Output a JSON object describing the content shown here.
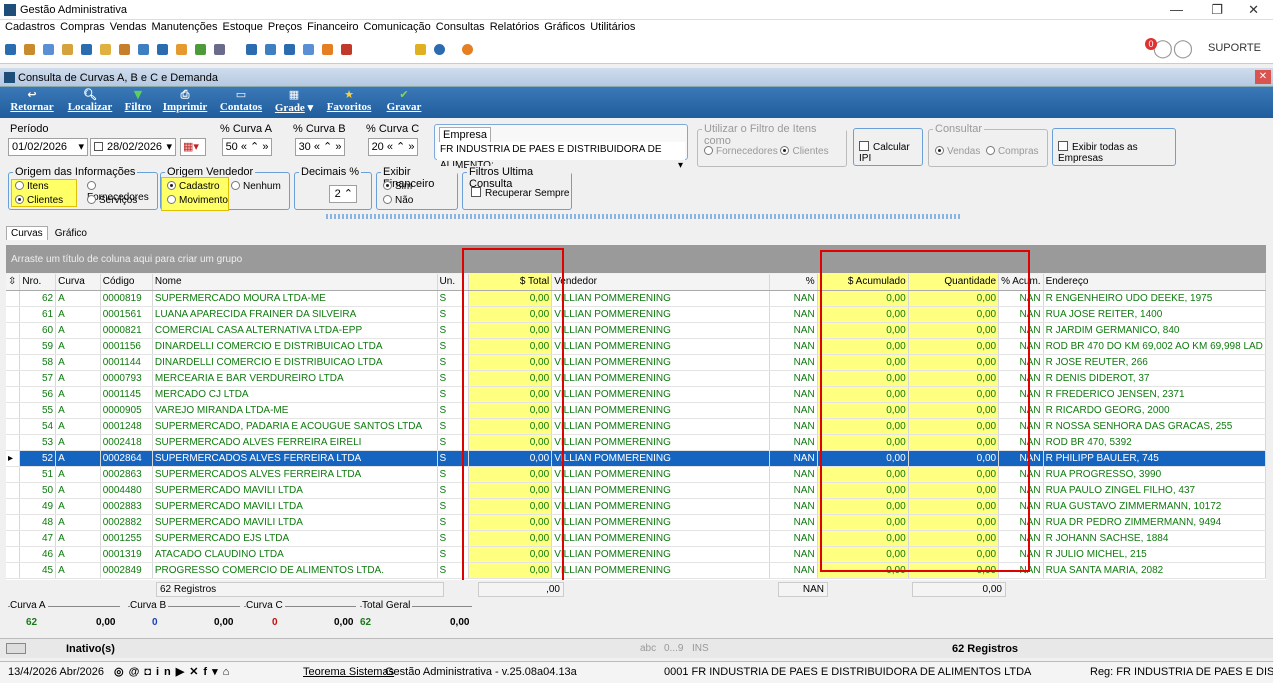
{
  "app": {
    "title": "Gestão Administrativa",
    "user": "SUPORTE",
    "badge": "0"
  },
  "menu": [
    "Cadastros",
    "Compras",
    "Vendas",
    "Manutenções",
    "Estoque",
    "Preços",
    "Financeiro",
    "Comunicação",
    "Consultas",
    "Relatórios",
    "Gráficos",
    "Utilitários"
  ],
  "window": {
    "title": "Consulta de Curvas A, B e C e Demanda"
  },
  "toolbar": {
    "retornar": "Retornar",
    "localizar": "Localizar",
    "filtro": "Filtro",
    "imprimir": "Imprimir",
    "contatos": "Contatos",
    "grade": "Grade",
    "favoritos": "Favoritos",
    "gravar": "Gravar"
  },
  "filters": {
    "periodo_label": "Período",
    "date_from": "01/02/2026",
    "date_to": "28/02/2026",
    "curva_a_label": "% Curva A",
    "curva_a": "50",
    "curva_b_label": "% Curva B",
    "curva_b": "30",
    "curva_c_label": "% Curva C",
    "curva_c": "20",
    "empresa_label": "Empresa",
    "empresa": "FR INDUSTRIA DE PAES E DISTRIBUIDORA DE ALIMENTO:",
    "filtro_itens_label": "Utilizar o Filtro de Itens como",
    "fornecedores": "Fornecedores",
    "clientes_opt": "Clientes",
    "calcular_ipi": "Calcular IPI",
    "consultar_label": "Consultar",
    "vendas": "Vendas",
    "compras": "Compras",
    "exibir_empresas": "Exibir todas as Empresas",
    "origem_info_label": "Origem das Informações",
    "itens": "Itens",
    "clientes": "Clientes",
    "fornecedores2": "Fornecedores",
    "servicos": "Serviços",
    "origem_vend_label": "Origem Vendedor",
    "cadastro": "Cadastro",
    "movimento": "Movimento",
    "nenhum": "Nenhum",
    "decimais_label": "Decimais %",
    "decimais": "2",
    "exibir_fin_label": "Exibir Financeiro",
    "sim": "Sim",
    "nao": "Não",
    "filtros_ult_label": "Filtros Ultima Consulta",
    "recuperar": "Recuperar Sempre"
  },
  "tabs": [
    "Curvas",
    "Gráfico"
  ],
  "group_hint": "Arraste um título de coluna aqui para criar um grupo",
  "columns": {
    "nro": "Nro.",
    "curva": "Curva",
    "codigo": "Código",
    "nome": "Nome",
    "un": "Un.",
    "total": "$ Total",
    "vendedor": "Vendedor",
    "pct": "%",
    "acum": "$ Acumulado",
    "qtd": "Quantidade",
    "pacum": "% Acum.",
    "end": "Endereço"
  },
  "rows": [
    [
      "62",
      "A",
      "0000819",
      "SUPERMERCADO MOURA LTDA-ME",
      "S",
      "0,00",
      "VILLIAN POMMERENING",
      "NAN",
      "0,00",
      "0,00",
      "NAN",
      "R ENGENHEIRO UDO DEEKE, 1975"
    ],
    [
      "61",
      "A",
      "0001561",
      "LUANA APARECIDA FRAINER DA SILVEIRA",
      "S",
      "0,00",
      "VILLIAN POMMERENING",
      "NAN",
      "0,00",
      "0,00",
      "NAN",
      "RUA JOSE REITER, 1400"
    ],
    [
      "60",
      "A",
      "0000821",
      "COMERCIAL CASA ALTERNATIVA LTDA-EPP",
      "S",
      "0,00",
      "VILLIAN POMMERENING",
      "NAN",
      "0,00",
      "0,00",
      "NAN",
      "R JARDIM GERMANICO, 840"
    ],
    [
      "59",
      "A",
      "0001156",
      "DINARDELLI COMERCIO E DISTRIBUICAO LTDA",
      "S",
      "0,00",
      "VILLIAN POMMERENING",
      "NAN",
      "0,00",
      "0,00",
      "NAN",
      "ROD BR 470 DO KM 69,002 AO KM 69,998 LAD"
    ],
    [
      "58",
      "A",
      "0001144",
      "DINARDELLI COMERCIO E DISTRIBUICAO LTDA",
      "S",
      "0,00",
      "VILLIAN POMMERENING",
      "NAN",
      "0,00",
      "0,00",
      "NAN",
      "R JOSE REUTER, 266"
    ],
    [
      "57",
      "A",
      "0000793",
      "MERCEARIA E BAR VERDUREIRO LTDA",
      "S",
      "0,00",
      "VILLIAN POMMERENING",
      "NAN",
      "0,00",
      "0,00",
      "NAN",
      "R DENIS DIDEROT, 37"
    ],
    [
      "56",
      "A",
      "0001145",
      "MERCADO CJ LTDA",
      "S",
      "0,00",
      "VILLIAN POMMERENING",
      "NAN",
      "0,00",
      "0,00",
      "NAN",
      "R FREDERICO JENSEN, 2371"
    ],
    [
      "55",
      "A",
      "0000905",
      "VAREJO MIRANDA LTDA-ME",
      "S",
      "0,00",
      "VILLIAN POMMERENING",
      "NAN",
      "0,00",
      "0,00",
      "NAN",
      "R RICARDO GEORG, 2000"
    ],
    [
      "54",
      "A",
      "0001248",
      "SUPERMERCADO, PADARIA E ACOUGUE SANTOS LTDA",
      "S",
      "0,00",
      "VILLIAN POMMERENING",
      "NAN",
      "0,00",
      "0,00",
      "NAN",
      "R NOSSA SENHORA DAS GRACAS, 255"
    ],
    [
      "53",
      "A",
      "0002418",
      "SUPERMERCADO ALVES FERREIRA EIRELI",
      "S",
      "0,00",
      "VILLIAN POMMERENING",
      "NAN",
      "0,00",
      "0,00",
      "NAN",
      "ROD BR 470, 5392"
    ],
    [
      "52",
      "A",
      "0002864",
      "SUPERMERCADOS ALVES FERREIRA LTDA",
      "S",
      "0,00",
      "VILLIAN POMMERENING",
      "NAN",
      "0,00",
      "0,00",
      "NAN",
      "R PHILIPP BAULER, 745"
    ],
    [
      "51",
      "A",
      "0002863",
      "SUPERMERCADOS ALVES FERREIRA LTDA",
      "S",
      "0,00",
      "VILLIAN POMMERENING",
      "NAN",
      "0,00",
      "0,00",
      "NAN",
      "RUA PROGRESSO, 3990"
    ],
    [
      "50",
      "A",
      "0004480",
      "SUPERMERCADO MAVILI LTDA",
      "S",
      "0,00",
      "VILLIAN POMMERENING",
      "NAN",
      "0,00",
      "0,00",
      "NAN",
      "RUA PAULO ZINGEL FILHO, 437"
    ],
    [
      "49",
      "A",
      "0002883",
      "SUPERMERCADO MAVILI LTDA",
      "S",
      "0,00",
      "VILLIAN POMMERENING",
      "NAN",
      "0,00",
      "0,00",
      "NAN",
      "RUA GUSTAVO ZIMMERMANN, 10172"
    ],
    [
      "48",
      "A",
      "0002882",
      "SUPERMERCADO MAVILI LTDA",
      "S",
      "0,00",
      "VILLIAN POMMERENING",
      "NAN",
      "0,00",
      "0,00",
      "NAN",
      "RUA DR PEDRO ZIMMERMANN, 9494"
    ],
    [
      "47",
      "A",
      "0001255",
      "SUPERMERCADO EJS LTDA",
      "S",
      "0,00",
      "VILLIAN POMMERENING",
      "NAN",
      "0,00",
      "0,00",
      "NAN",
      "R JOHANN SACHSE, 1884"
    ],
    [
      "46",
      "A",
      "0001319",
      "ATACADO CLAUDINO LTDA",
      "S",
      "0,00",
      "VILLIAN POMMERENING",
      "NAN",
      "0,00",
      "0,00",
      "NAN",
      "R JULIO MICHEL, 215"
    ],
    [
      "45",
      "A",
      "0002849",
      "PROGRESSO COMERCIO DE ALIMENTOS LTDA.",
      "S",
      "0,00",
      "VILLIAN POMMERENING",
      "NAN",
      "0,00",
      "0,00",
      "NAN",
      "RUA SANTA MARIA, 2082"
    ]
  ],
  "selected_row": 10,
  "footer": {
    "registros": "62 Registros",
    "total": ",00",
    "pct": "NAN",
    "acum": "0,00"
  },
  "summary": [
    {
      "label": "Curva A",
      "count": "62",
      "value": "0,00",
      "color": "#1a7a1a"
    },
    {
      "label": "Curva B",
      "count": "0",
      "value": "0,00",
      "color": "#1a3fb5"
    },
    {
      "label": "Curva C",
      "count": "0",
      "value": "0,00",
      "color": "#c01010"
    },
    {
      "label": "Total Geral",
      "count": "62",
      "value": "0,00",
      "color": "#1a7a1a"
    }
  ],
  "status": {
    "inativos": "Inativo(s)",
    "kb1": "abc",
    "kb2": "0...9",
    "kb3": "INS",
    "registros": "62 Registros"
  },
  "bottom": {
    "date": "13/4/2026 Abr/2026",
    "teorema": "Teorema Sistemas",
    "versao": "Gestão Administrativa - v.25.08a04.13a",
    "empresa": "0001 FR INDUSTRIA DE PAES E DISTRIBUIDORA DE ALIMENTOS LTDA",
    "reg": "Reg: FR INDUSTRIA DE PAES E DISTRIBU"
  }
}
